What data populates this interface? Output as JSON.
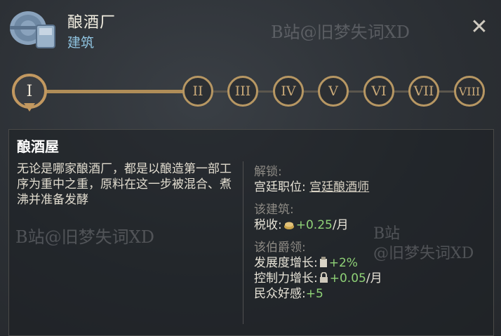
{
  "header": {
    "title": "酿酒厂",
    "subtitle": "建筑",
    "close_label": "✕"
  },
  "watermarks": [
    "B站@旧梦失词XD",
    "B站@旧梦失词XD",
    "B站",
    "@旧梦失词XD"
  ],
  "levels": [
    "I",
    "II",
    "III",
    "IV",
    "V",
    "VI",
    "VII",
    "VIII"
  ],
  "panel": {
    "title": "酿酒屋",
    "description": "无论是哪家酿酒厂，都是以酿造第一部工序为重中之重，原料在这一步被混合、煮沸并准备发酵",
    "unlock_label": "解锁:",
    "court_position_label": "宫廷职位:",
    "court_position_value": "宫廷酿酒师",
    "building_label": "该建筑:",
    "tax_label": "税收:",
    "tax_value": "+0.25",
    "tax_unit": "/月",
    "county_label": "该伯爵领:",
    "development_label": "发展度增长:",
    "development_value": "+2%",
    "control_label": "控制力增长:",
    "control_value": "+0.05",
    "control_unit": "/月",
    "popular_label": "民众好感:",
    "popular_value": "+5"
  }
}
